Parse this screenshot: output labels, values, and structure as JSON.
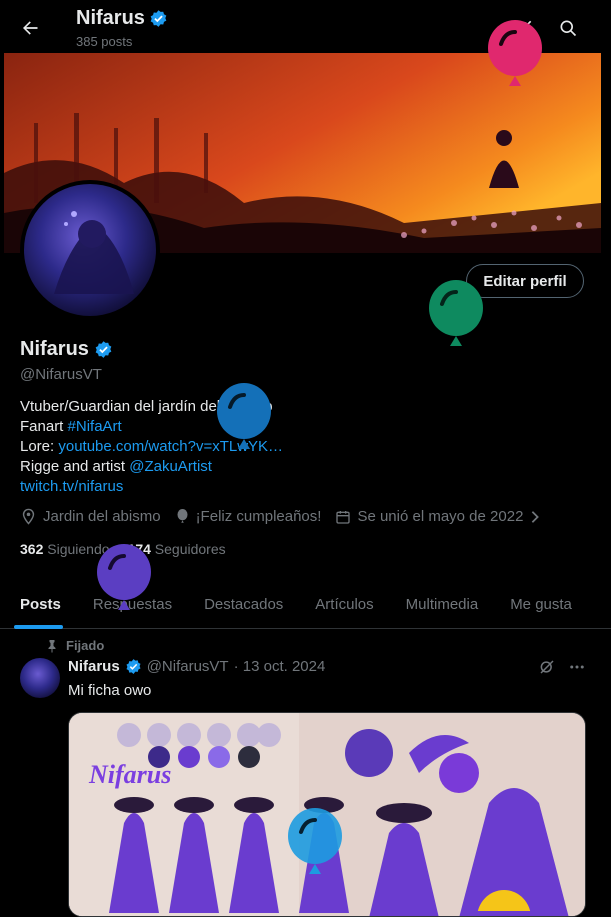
{
  "header": {
    "name": "Nifarus",
    "posts_count": "385 posts"
  },
  "profile": {
    "display_name": "Nifarus",
    "handle": "@NifarusVT",
    "edit_button": "Editar perfil",
    "bio": {
      "line1": "Vtuber/Guardian del jardín del abismo",
      "line2_prefix": "Fanart ",
      "line2_hashtag": "#NifaArt",
      "line3_prefix": "Lore: ",
      "line3_link": "youtube.com/watch?v=xTLwYK…",
      "line4_prefix": "Rigge and artist ",
      "line4_mention": "@ZakuArtist",
      "line5_link": "twitch.tv/nifarus"
    },
    "location": "Jardin del abismo",
    "birthday": "¡Feliz cumpleaños!",
    "joined": "Se unió el mayo de 2022",
    "following_count": "362",
    "following_label": "Siguiendo",
    "followers_count": "174",
    "followers_label": "Seguidores"
  },
  "tabs": [
    {
      "label": "Posts"
    },
    {
      "label": "Respuestas"
    },
    {
      "label": "Destacados"
    },
    {
      "label": "Artículos"
    },
    {
      "label": "Multimedia"
    },
    {
      "label": "Me gusta"
    }
  ],
  "pinned_post": {
    "pinned_label": "Fijado",
    "author": "Nifarus",
    "handle": "@NifarusVT",
    "date": "· 13 oct. 2024",
    "text": "Mi ficha owo",
    "media_logo_text": "Nifarus"
  },
  "colors": {
    "accent": "#1d9bf0",
    "background": "#000000",
    "muted": "#71767b",
    "balloon_pink": "#e0286e",
    "balloon_green": "#0e8a5f",
    "balloon_blue": "#1470b8",
    "balloon_purple": "#5b3ec2",
    "balloon_cyan": "#1d9be0"
  }
}
